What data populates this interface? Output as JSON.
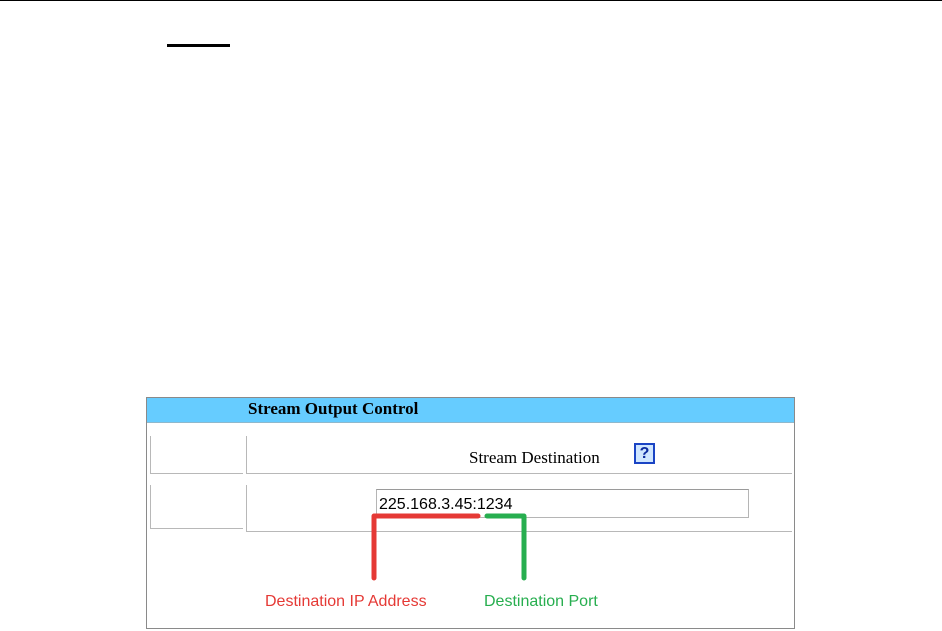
{
  "panel": {
    "title": "Stream Output Control",
    "destination_label": "Stream Destination",
    "help_icon_text": "?",
    "destination_value": "225.168.3.45:1234"
  },
  "annotations": {
    "ip_label": "Destination IP Address",
    "port_label": "Destination Port",
    "ip_color": "#e53935",
    "port_color": "#27ae4f"
  },
  "colors": {
    "header_bg": "#66ccff",
    "help_icon_border": "#1a44c4"
  }
}
